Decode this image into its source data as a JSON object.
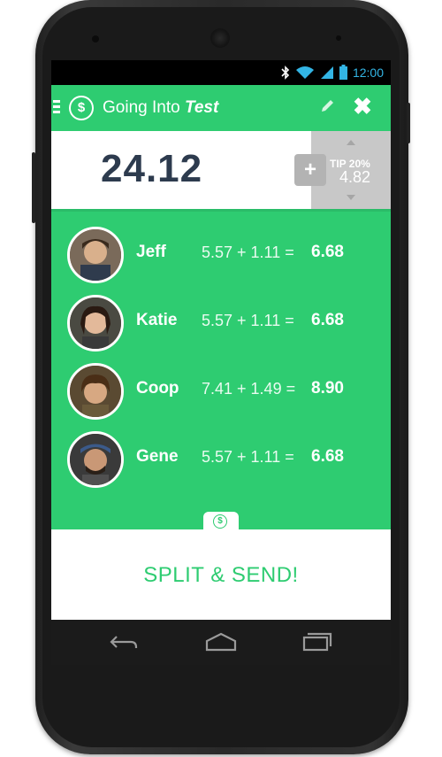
{
  "status_bar": {
    "time": "12:00",
    "icons": [
      "bluetooth-icon",
      "wifi-icon",
      "signal-icon",
      "battery-icon"
    ]
  },
  "app_bar": {
    "title_prefix": "Going Into",
    "title_name": "Test",
    "icons": [
      "menu-icon",
      "dollar-icon",
      "edit-icon",
      "close-icon"
    ]
  },
  "bill": {
    "amount": "24.12"
  },
  "tip": {
    "plus_label": "+",
    "label": "TIP 20%",
    "value": "4.82"
  },
  "people": [
    {
      "name": "Jeff",
      "calc": "5.57 + 1.11 =",
      "total": "6.68"
    },
    {
      "name": "Katie",
      "calc": "5.57 + 1.11 =",
      "total": "6.68"
    },
    {
      "name": "Coop",
      "calc": "7.41 + 1.49 =",
      "total": "8.90"
    },
    {
      "name": "Gene",
      "calc": "5.57 + 1.11 =",
      "total": "6.68"
    }
  ],
  "split": {
    "button_label": "SPLIT & SEND!"
  },
  "colors": {
    "accent": "#2ecc71",
    "amount_text": "#2d3b4e",
    "status_time": "#33b5e5",
    "tip_panel": "#c8c8c8"
  }
}
